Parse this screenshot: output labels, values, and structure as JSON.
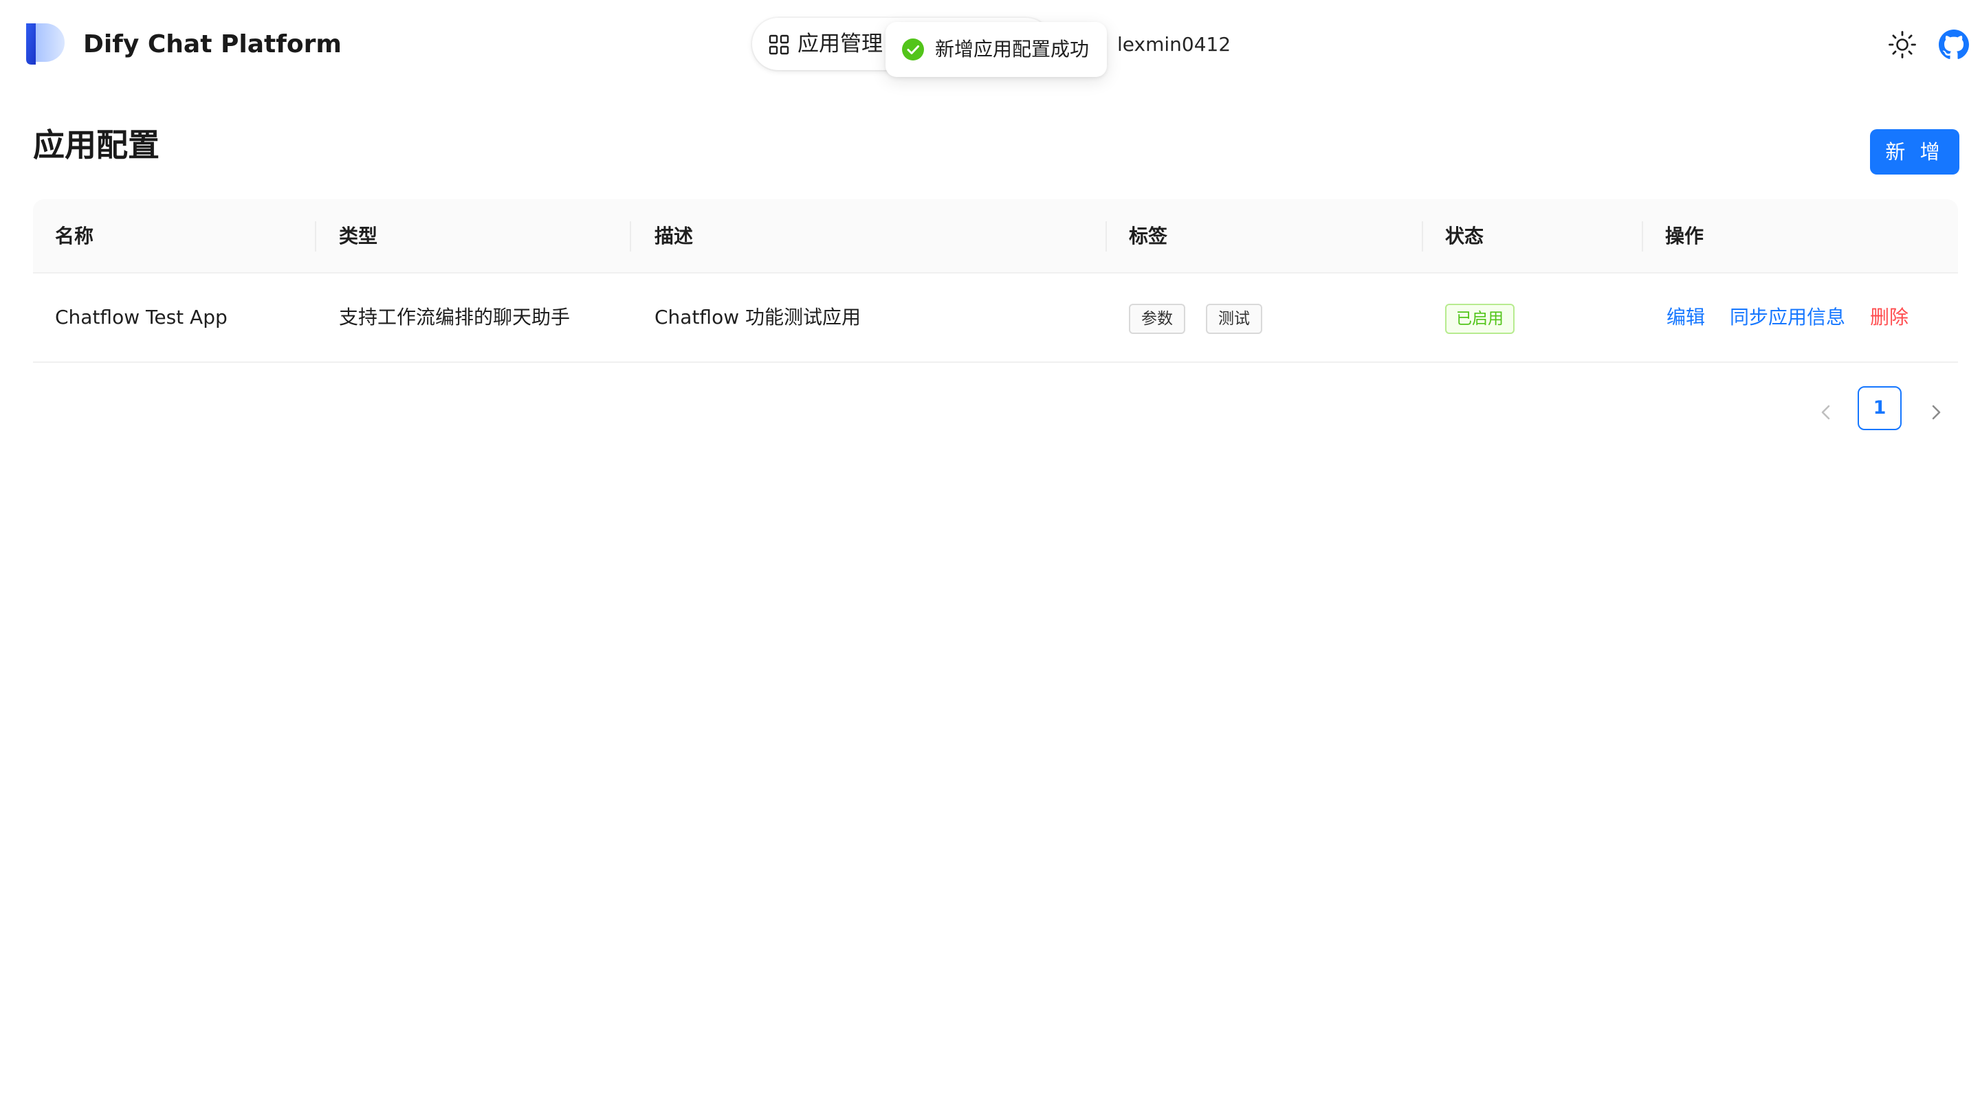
{
  "header": {
    "brand": "Dify Chat Platform",
    "nav_label": "应用管理",
    "username": "lexmin0412"
  },
  "toast": {
    "message": "新增应用配置成功"
  },
  "page": {
    "title": "应用配置",
    "add_button_label": "新 增"
  },
  "table": {
    "columns": [
      "名称",
      "类型",
      "描述",
      "标签",
      "状态",
      "操作"
    ],
    "rows": [
      {
        "name": "Chatflow Test App",
        "type": "支持工作流编排的聊天助手",
        "description": "Chatflow 功能测试应用",
        "tags": [
          "参数",
          "测试"
        ],
        "status": "已启用",
        "actions": [
          "编辑",
          "同步应用信息",
          "删除"
        ]
      }
    ]
  },
  "pagination": {
    "current_page": "1"
  },
  "icons": {
    "logo": "dify-logo",
    "nav": "app-grid-icon",
    "toast": "check-circle-icon",
    "theme": "sun-icon",
    "github": "github-icon",
    "prev": "chevron-left-icon",
    "next": "chevron-right-icon"
  },
  "colors": {
    "primary": "#1677ff",
    "success": "#52c41a",
    "danger": "#ff4d4f",
    "table_header_bg": "#fafafa"
  }
}
